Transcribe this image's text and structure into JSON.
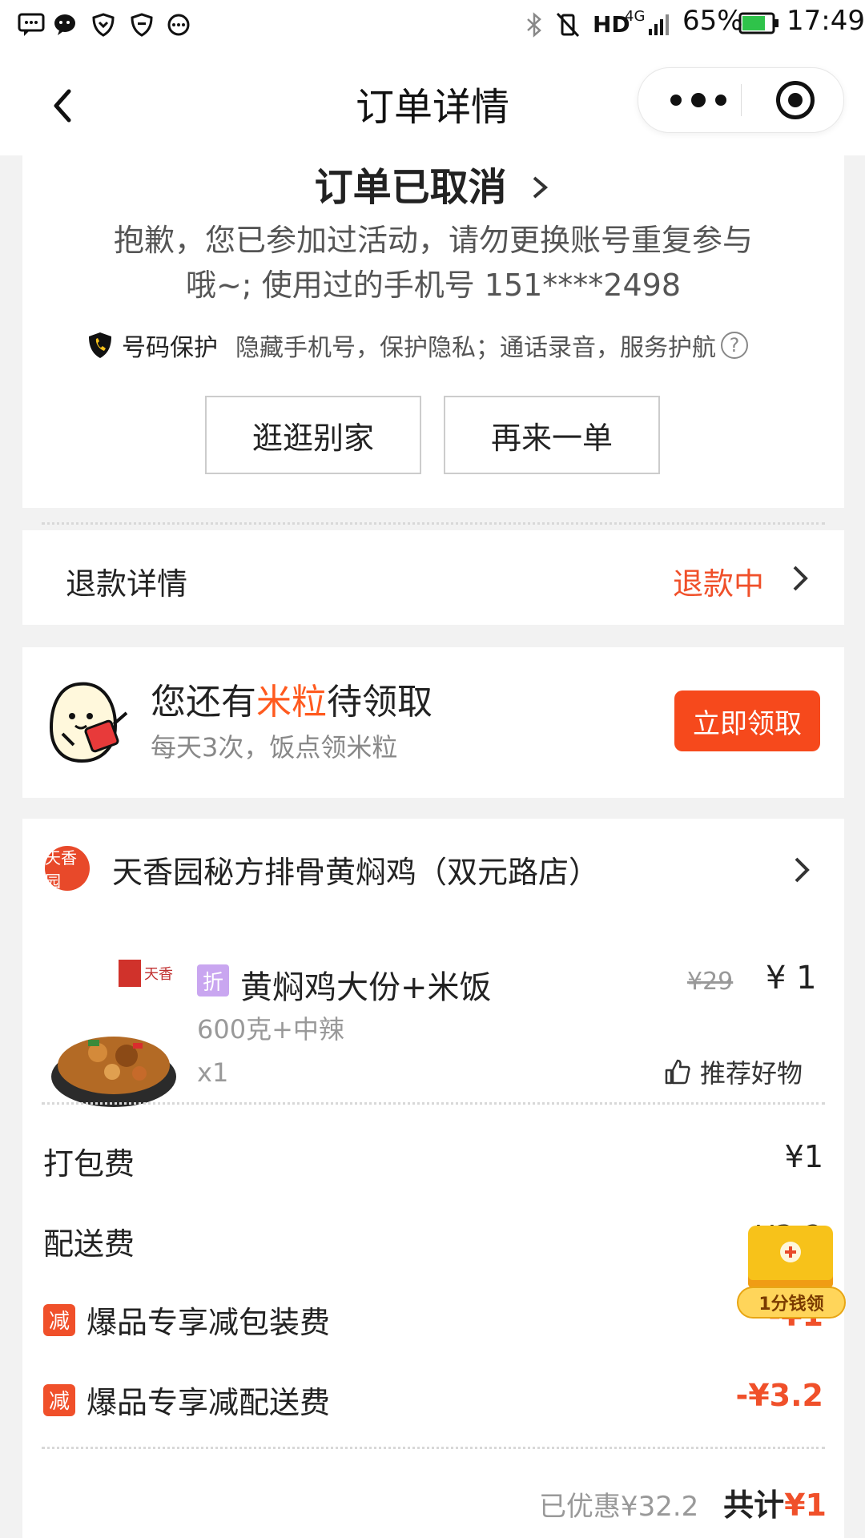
{
  "status_bar": {
    "battery": "65%",
    "time": "17:49",
    "network": "4G",
    "hd": "HD",
    "icons": [
      "message-icon",
      "wechat-icon",
      "heart-shield-icon",
      "shield-icon",
      "more-circle-icon",
      "bluetooth-icon",
      "no-vibrate-icon",
      "signal-icon",
      "battery-icon"
    ]
  },
  "nav": {
    "title": "订单详情"
  },
  "status_card": {
    "title": "订单已取消",
    "message": "抱歉，您已参加过活动，请勿更换账号重复参与哦~; 使用过的手机号 151****2498",
    "privacy_label": "号码保护",
    "privacy_text": "隐藏手机号，保护隐私；通话录音，服务护航",
    "browse_btn": "逛逛别家",
    "reorder_btn": "再来一单"
  },
  "refund": {
    "label": "退款详情",
    "status": "退款中"
  },
  "rice": {
    "title_pre": "您还有",
    "title_hl": "米粒",
    "title_post": "待领取",
    "subtitle": "每天3次，饭点领米粒",
    "button": "立即领取"
  },
  "order": {
    "store_name": "天香园秘方排骨黄焖鸡（双元路店）",
    "store_logo_text": "天香园",
    "item": {
      "tag": "折",
      "name": "黄焖鸡大份+米饭",
      "original_price": "¥29",
      "price": "¥ 1",
      "spec": "600克+中辣",
      "qty": "x1",
      "recommend": "推荐好物"
    },
    "fees": [
      {
        "label": "打包费",
        "value": "¥1",
        "badge": ""
      },
      {
        "label": "配送费",
        "value": "¥3.2",
        "badge": ""
      },
      {
        "label": "爆品专享减包装费",
        "value": "-¥1",
        "badge": "减"
      },
      {
        "label": "爆品专享减配送费",
        "value": "-¥3.2",
        "badge": "减"
      }
    ],
    "summary": {
      "saved": "已优惠¥32.2",
      "total_label": "共计",
      "total_value": "¥1"
    }
  },
  "floating_promo": {
    "label": "1分钱领"
  },
  "colors": {
    "accent": "#f0502a",
    "button": "#f6491c",
    "rice_highlight": "#ff5a1f",
    "tag_purple": "#c9a6f0"
  }
}
